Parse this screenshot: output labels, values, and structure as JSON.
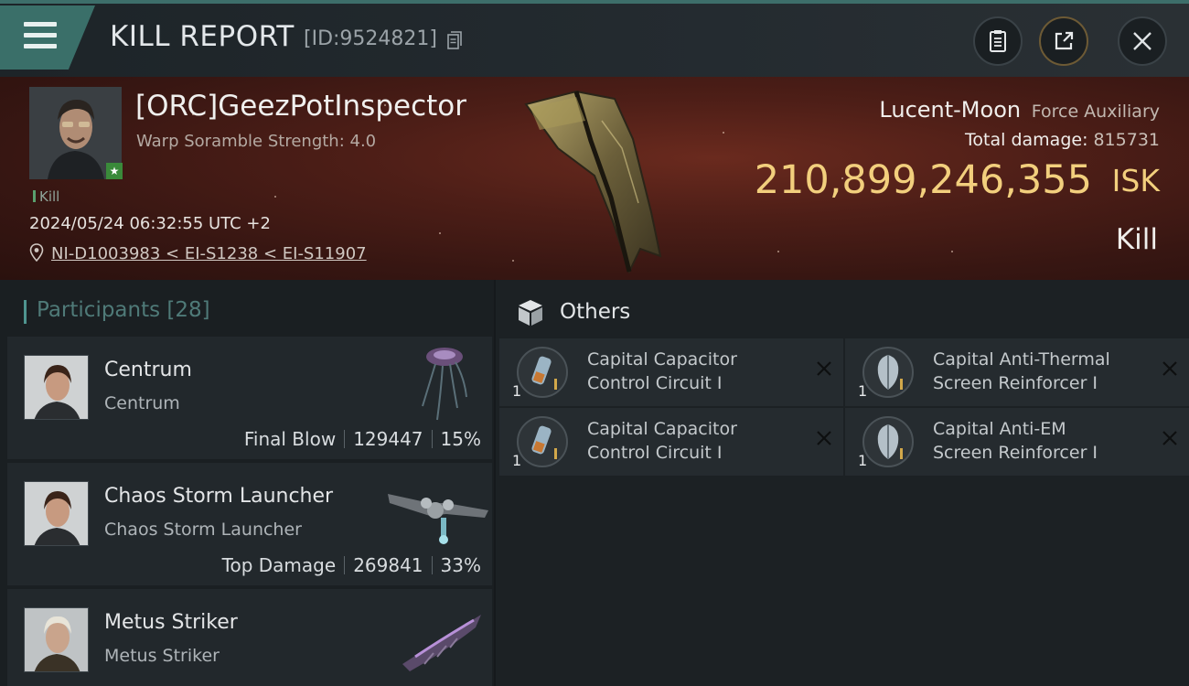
{
  "header": {
    "title": "KILL REPORT",
    "report_id": "[ID:9524821]"
  },
  "victim": {
    "name": "[ORC]GeezPotInspector",
    "subtitle": "Warp Soramble Strength: 4.0",
    "status_tag": "Kill",
    "datetime": "2024/05/24 06:32:55 UTC +2",
    "location": "NI-D1003983 < EI-S1238 < EI-S11907",
    "ship_name": "Lucent-Moon",
    "ship_class": "Force Auxiliary",
    "total_damage_label": "Total damage:",
    "total_damage": "815731",
    "isk_value": "210,899,246,355",
    "isk_unit": "ISK",
    "result": "Kill"
  },
  "participants": {
    "title": "Participants",
    "count": "[28]",
    "rows": [
      {
        "name": "Centrum",
        "corp": "Centrum",
        "role": "Final Blow",
        "damage": "129447",
        "percent": "15%"
      },
      {
        "name": "Chaos Storm Launcher",
        "corp": "Chaos Storm Launcher",
        "role": "Top Damage",
        "damage": "269841",
        "percent": "33%"
      },
      {
        "name": "Metus Striker",
        "corp": "Metus Striker"
      }
    ]
  },
  "others": {
    "title": "Others",
    "items": [
      {
        "line1": "Capital Capacitor",
        "line2": "Control Circuit I",
        "qty": "1"
      },
      {
        "line1": "Capital Anti-Thermal",
        "line2": "Screen Reinforcer I",
        "qty": "1"
      },
      {
        "line1": "Capital Capacitor",
        "line2": "Control Circuit I",
        "qty": "1"
      },
      {
        "line1": "Capital Anti-EM",
        "line2": "Screen Reinforcer I",
        "qty": "1"
      }
    ]
  },
  "colors": {
    "accent_teal": "#3a6f69",
    "isk_gold": "#f2cf7d",
    "banner_red": "#4d1e17"
  }
}
